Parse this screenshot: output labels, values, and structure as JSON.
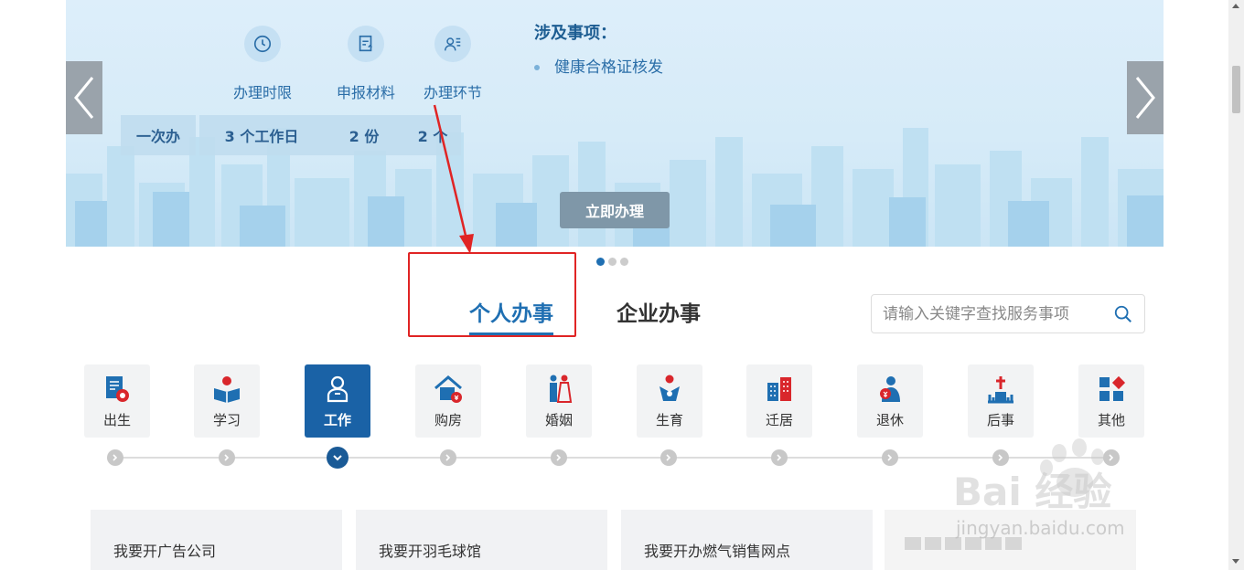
{
  "banner": {
    "stats": [
      {
        "icon": "clock-icon",
        "label": "办理时限"
      },
      {
        "icon": "document-upload-icon",
        "label": "申报材料"
      },
      {
        "icon": "process-person-icon",
        "label": "办理环节"
      }
    ],
    "stat_values": [
      "一次办",
      "3 个工作日",
      "2 份",
      "2 个"
    ],
    "involve_title": "涉及事项：",
    "involve_item": "健康合格证核发",
    "action_label": "立即办理",
    "slide_count": 3,
    "active_slide": 1
  },
  "tabs": {
    "personal": "个人办事",
    "business": "企业办事",
    "active": "personal"
  },
  "search": {
    "placeholder": "请输入关键字查找服务事项",
    "value": ""
  },
  "categories": [
    {
      "label": "出生",
      "icon": "birth-certificate-icon"
    },
    {
      "label": "学习",
      "icon": "study-icon"
    },
    {
      "label": "工作",
      "icon": "work-icon",
      "active": true
    },
    {
      "label": "购房",
      "icon": "house-purchase-icon"
    },
    {
      "label": "婚姻",
      "icon": "marriage-icon"
    },
    {
      "label": "生育",
      "icon": "childbirth-icon"
    },
    {
      "label": "迁居",
      "icon": "relocation-icon"
    },
    {
      "label": "退休",
      "icon": "retirement-icon"
    },
    {
      "label": "后事",
      "icon": "funeral-icon"
    },
    {
      "label": "其他",
      "icon": "other-icon"
    }
  ],
  "cards": [
    "我要开广告公司",
    "我要开羽毛球馆",
    "我要开办燃气销售网点"
  ],
  "watermark": {
    "text": "Bai 经验",
    "url": "jingyan.baidu.com"
  },
  "colors": {
    "primary": "#1f6fb2",
    "active_tile": "#1a62a6",
    "annotation_red": "#e02424",
    "banner_bg": "#ddeefa"
  }
}
